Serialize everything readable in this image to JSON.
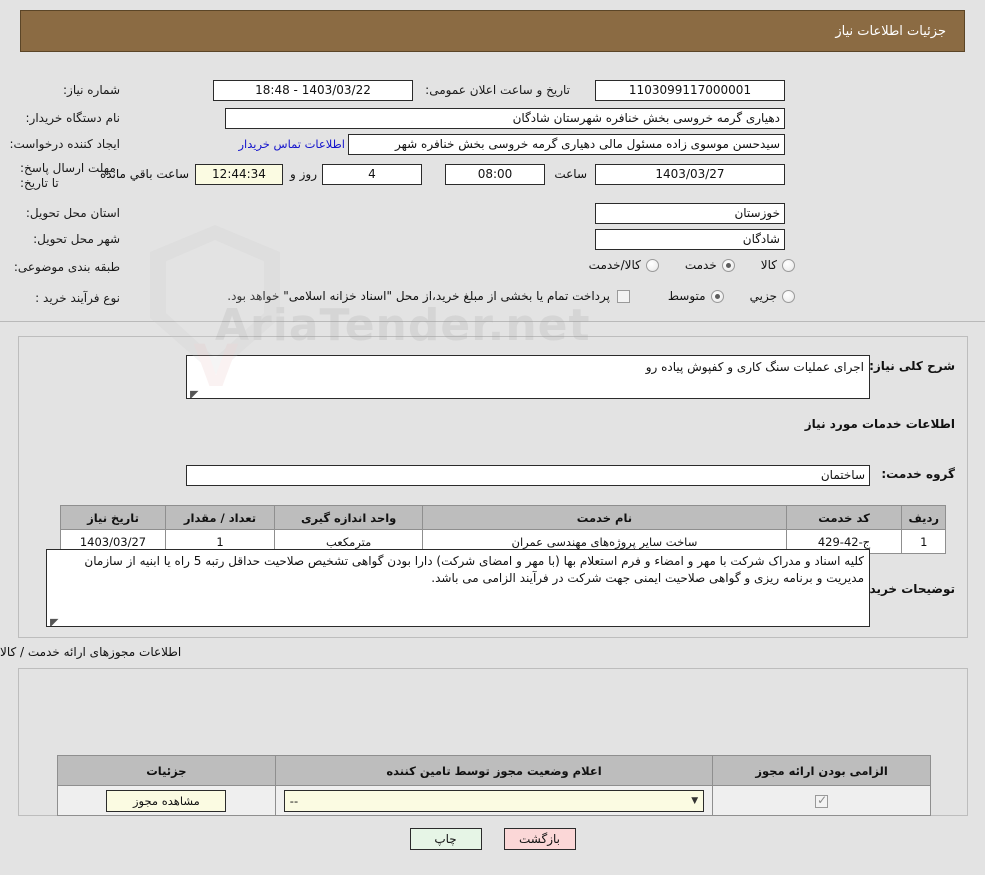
{
  "header": {
    "title": "جزئیات اطلاعات نیاز"
  },
  "watermark": {
    "text": "AriaTender.net"
  },
  "top_form": {
    "need_number_label": "شماره نیاز:",
    "need_number_value": "1103099117000001",
    "public_announce_label": "تاریخ و ساعت اعلان عمومی:",
    "public_announce_value": "1403/03/22 - 18:48",
    "buyer_org_label": "نام دستگاه خریدار:",
    "buyer_org_value": "دهیاری گرمه خروسی بخش خنافره شهرستان شادگان",
    "creator_label": "ایجاد کننده درخواست:",
    "creator_value": "سیدحسن موسوی زاده مسئول مالی دهیاری گرمه خروسی بخش خنافره شهر",
    "contact_link": "اطلاعات تماس خریدار",
    "deadline_label": "مهلت ارسال پاسخ: تا تاریخ:",
    "deadline_date": "1403/03/27",
    "hour_label": "ساعت",
    "deadline_time": "08:00",
    "days_remaining": "4",
    "days_word": "روز و",
    "countdown": "12:44:34",
    "remaining_word": "ساعت باقي مانده",
    "province_label": "استان محل تحویل:",
    "province_value": "خوزستان",
    "city_label": "شهر محل تحویل:",
    "city_value": "شادگان",
    "category_label": "طبقه بندی موضوعی:",
    "category_options": [
      {
        "label": "کالا",
        "selected": false
      },
      {
        "label": "خدمت",
        "selected": true
      },
      {
        "label": "کالا/خدمت",
        "selected": false
      }
    ],
    "process_label": "نوع فرآیند خرید :",
    "process_options": [
      {
        "label": "جزیي",
        "selected": false
      },
      {
        "label": "متوسط",
        "selected": true
      }
    ],
    "treasury_checkbox_label": "پرداخت تمام یا بخشی از مبلغ خرید،از محل \"اسناد خزانه اسلامی\" خواهد بود.",
    "treasury_checked": false
  },
  "mid": {
    "need_desc_label": "شرح کلی نیاز:",
    "need_desc_value": "اجرای عملیات سنگ کاری و کفپوش پیاده رو",
    "services_heading": "اطلاعات خدمات مورد نیاز",
    "service_group_label": "گروه خدمت:",
    "service_group_value": "ساختمان",
    "buyer_notes_label": "توضیحات خریدار:",
    "buyer_notes_value": "کلیه اسناد و مدراک شرکت با مهر و امضاء و فرم استعلام بها (با مهر و امضای شرکت) دارا بودن گواهی تشخیص صلاحیت حداقل رتبه 5 راه یا ابنیه از سازمان مدیریت و برنامه ریزی و گواهی صلاحیت ایمنی جهت شرکت در فرآیند الزامی می باشد."
  },
  "services_table": {
    "headers": [
      "ردیف",
      "کد خدمت",
      "نام خدمت",
      "واحد اندازه گیری",
      "تعداد / مقدار",
      "تاریخ نیاز"
    ],
    "rows": [
      [
        "1",
        "ج-42-429",
        "ساخت سایر پروژه‌های مهندسی عمران",
        "مترمکعب",
        "1",
        "1403/03/27"
      ]
    ]
  },
  "licenses": {
    "heading": "اطلاعات مجوزهای ارائه خدمت / کالا",
    "headers": [
      "الزامی بودن ارائه مجوز",
      "اعلام وضعیت مجوز توسط تامین کننده",
      "جزئیات"
    ],
    "row": {
      "required_checked": true,
      "status_value": "--",
      "details_button": "مشاهده مجوز"
    }
  },
  "footer": {
    "back_button": "بازگشت",
    "print_button": "چاپ"
  }
}
